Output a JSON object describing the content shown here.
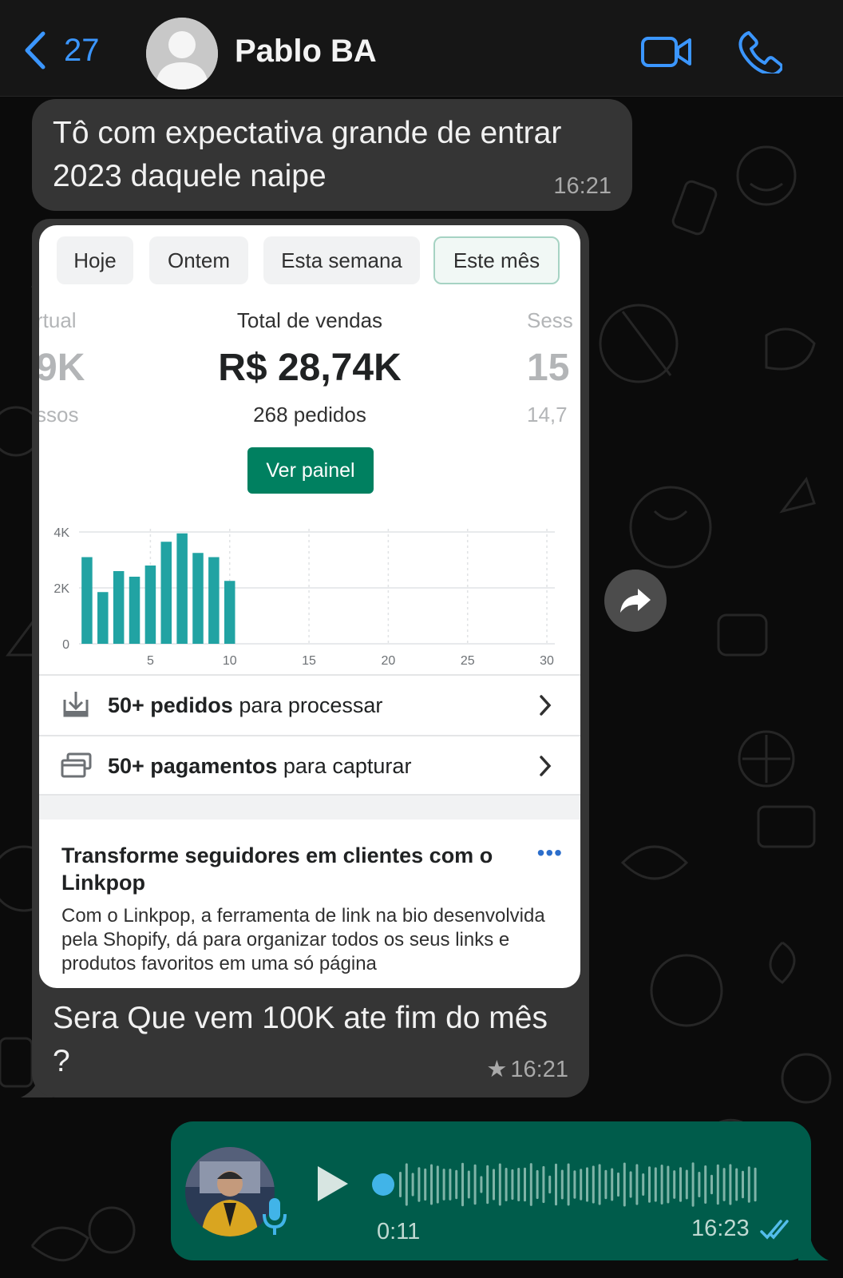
{
  "header": {
    "back_count": "27",
    "contact_name": "Pablo BA",
    "icons": [
      "chevron-left-icon",
      "profile-placeholder-icon",
      "video-camera-icon",
      "phone-icon"
    ],
    "accent_color": "#3b96ff"
  },
  "messages": [
    {
      "direction": "incoming",
      "text": "Tô com expectativa grande de entrar 2023 daquele naipe",
      "time": "16:21"
    },
    {
      "direction": "incoming",
      "type": "image",
      "caption": "Sera Que vem 100K ate fim do mês ?",
      "time": "16:21",
      "starred": true
    },
    {
      "direction": "outgoing",
      "type": "voice",
      "duration": "0:11",
      "time": "16:23",
      "status": "read",
      "status_color": "#53bdeb"
    }
  ],
  "screenshot": {
    "tabs": [
      {
        "label": "Hoje",
        "active": false
      },
      {
        "label": "Ontem",
        "active": false
      },
      {
        "label": "Esta semana",
        "active": false
      },
      {
        "label": "Este mês",
        "active": true
      }
    ],
    "stat_left": {
      "label": "rtual",
      "value": "9K",
      "sub": "ssos"
    },
    "stat_main": {
      "label": "Total de vendas",
      "value": "R$ 28,74K",
      "sub": "268 pedidos"
    },
    "stat_right": {
      "label": "Sess",
      "value": "15",
      "sub": "14,7"
    },
    "button_label": "Ver painel",
    "brand_color": "#008060",
    "rows": [
      {
        "bold": "50+ pedidos",
        "rest": " para processar",
        "icon": "download-box-icon"
      },
      {
        "bold": "50+ pagamentos",
        "rest": " para capturar",
        "icon": "cards-icon"
      }
    ],
    "promo": {
      "title": "Transforme seguidores em clientes com o Linkpop",
      "more": "•••",
      "body": "Com o Linkpop, a ferramenta de link na bio desenvolvida pela Shopify, dá para organizar todos os seus links e produtos favoritos em uma só página"
    }
  },
  "chart_data": {
    "type": "bar",
    "x": [
      1,
      2,
      3,
      4,
      5,
      6,
      7,
      8,
      9,
      10
    ],
    "values": [
      3100,
      1850,
      2600,
      2400,
      2800,
      3650,
      3950,
      3250,
      3100,
      2250
    ],
    "xticks": [
      5,
      10,
      15,
      20,
      25,
      30
    ],
    "yticks": [
      "0",
      "2K",
      "4K"
    ],
    "xlim": [
      0.5,
      30.5
    ],
    "ylim": [
      0,
      4000
    ],
    "grid": true,
    "bar_color": "#21a3a3"
  }
}
